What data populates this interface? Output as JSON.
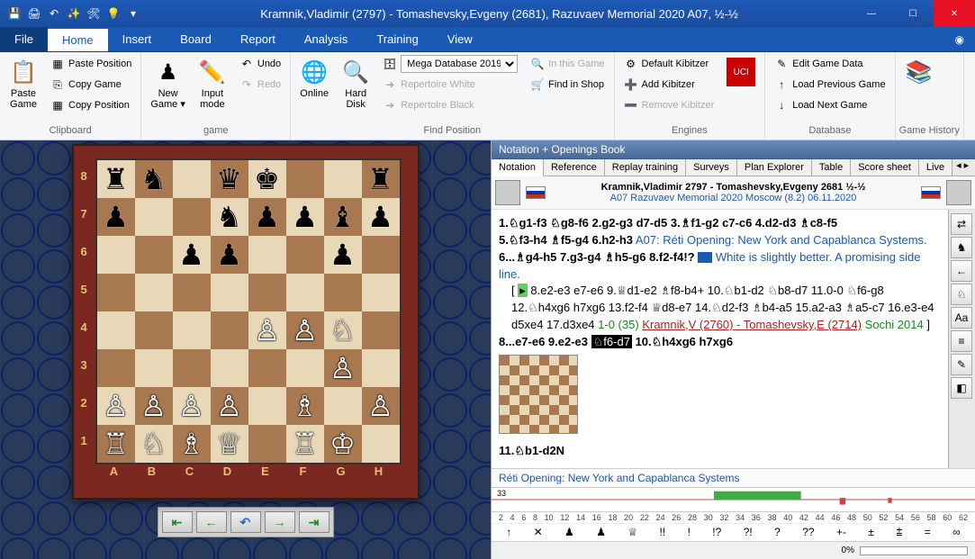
{
  "title": "Kramnik,Vladimir (2797) - Tomashevsky,Evgeny (2681), Razuvaev Memorial 2020  A07, ½-½",
  "menu": {
    "file": "File",
    "home": "Home",
    "insert": "Insert",
    "board": "Board",
    "report": "Report",
    "analysis": "Analysis",
    "training": "Training",
    "view": "View"
  },
  "ribbon": {
    "clipboard": {
      "title": "Clipboard",
      "paste_game": "Paste\nGame",
      "paste_position": "Paste Position",
      "copy_game": "Copy Game",
      "copy_position": "Copy Position"
    },
    "game": {
      "title": "game",
      "new_game": "New\nGame ▾",
      "input_mode": "Input\nmode",
      "undo": "Undo",
      "redo": "Redo"
    },
    "find": {
      "title": "Find Position",
      "online": "Online",
      "hard_disk": "Hard\nDisk",
      "db_select": "Mega Database 2019",
      "repertoire_white": "Repertoire White",
      "repertoire_black": "Repertoire Black",
      "in_this_game": "In this Game",
      "find_in_shop": "Find in Shop"
    },
    "engines": {
      "title": "Engines",
      "default_kibitzer": "Default Kibitzer",
      "add_kibitzer": "Add Kibitzer",
      "remove_kibitzer": "Remove Kibitzer"
    },
    "database": {
      "title": "Database",
      "edit_game": "Edit Game Data",
      "load_prev": "Load Previous Game",
      "load_next": "Load Next Game"
    },
    "history": {
      "title": "Game History"
    }
  },
  "board": {
    "ranks": [
      "8",
      "7",
      "6",
      "5",
      "4",
      "3",
      "2",
      "1"
    ],
    "files": [
      "A",
      "B",
      "C",
      "D",
      "E",
      "F",
      "G",
      "H"
    ],
    "position": [
      [
        "r",
        "n",
        ".",
        "q",
        "k",
        ".",
        ".",
        "r"
      ],
      [
        "p",
        ".",
        ".",
        "n",
        "p",
        "p",
        "b",
        "p"
      ],
      [
        ".",
        ".",
        "p",
        "p",
        ".",
        ".",
        "p",
        "."
      ],
      [
        ".",
        ".",
        ".",
        ".",
        ".",
        ".",
        ".",
        "."
      ],
      [
        ".",
        ".",
        ".",
        ".",
        "P",
        "P",
        "N",
        "."
      ],
      [
        ".",
        ".",
        ".",
        ".",
        ".",
        ".",
        "P",
        "."
      ],
      [
        "P",
        "P",
        "P",
        "P",
        ".",
        "B",
        ".",
        "P"
      ],
      [
        "R",
        "N",
        "B",
        "Q",
        ".",
        "R",
        "K",
        "."
      ]
    ]
  },
  "nav": {
    "first": "⇤",
    "prev": "←",
    "undo": "↶",
    "next": "→",
    "last": "⇥"
  },
  "pane": {
    "header": "Notation + Openings Book",
    "tabs": [
      "Notation",
      "Reference",
      "Replay training",
      "Surveys",
      "Plan Explorer",
      "Table",
      "Score sheet",
      "Live"
    ],
    "active_tab": 0,
    "game_header": {
      "white": "Kramnik,Vladimir",
      "white_elo": "2797",
      "black": "Tomashevsky,Evgeny",
      "black_elo": "2681",
      "result": "½-½",
      "event": "A07 Razuvaev Memorial 2020 Moscow (8.2) 06.11.2020"
    },
    "notation": {
      "main1": "1.♘g1-f3 ♘g8-f6 2.g2-g3 d7-d5 3.♗f1-g2 c7-c6 4.d2-d3 ♗c8-f5",
      "main2": "5.♘f3-h4 ♗f5-g4 6.h2-h3",
      "opening_link": "A07: Réti Opening: New York and Capablanca Systems.",
      "main3": "6...♗g4-h5 7.g3-g4 ♗h5-g6 8.f2-f4!?",
      "comment1": "White is slightly better. A promising side line.",
      "sub1": "8.e2-e3 e7-e6 9.♕d1-e2 ♗f8-b4+ 10.♘b1-d2 ♘b8-d7 11.0-0 ♘f6-g8 12.♘h4xg6 h7xg6 13.f2-f4 ♕d8-e7 14.♘d2-f3 ♗b4-a5 15.a2-a3 ♗a5-c7 16.e3-e4 d5xe4 17.d3xe4",
      "sub1_result": "1-0 (35)",
      "sub1_ref": "Kramnik,V (2760) - Tomashevsky,E (2714)",
      "sub1_place": "Sochi 2014",
      "main4": "8...e7-e6 9.e2-e3",
      "hl_move": "♘f6-d7",
      "main5": "10.♘h4xg6 h7xg6",
      "novelty": "11.♘b1-d2N"
    },
    "opening_bar": "Réti Opening: New York and Capablanca Systems",
    "eval_label": "33",
    "scale": [
      "2",
      "4",
      "6",
      "8",
      "10",
      "12",
      "14",
      "16",
      "18",
      "20",
      "22",
      "24",
      "26",
      "28",
      "30",
      "32",
      "34",
      "36",
      "38",
      "40",
      "42",
      "44",
      "46",
      "48",
      "50",
      "52",
      "54",
      "56",
      "58",
      "60",
      "62"
    ],
    "symbols": [
      "↑",
      "✕",
      "♟",
      "♟",
      "♕",
      "!!",
      "!",
      "!?",
      "?!",
      "?",
      "??",
      "+-",
      "±",
      "⩲",
      "=",
      "∞"
    ],
    "progress": "0%"
  },
  "side_tools": [
    "⇄",
    "♞",
    "←",
    "♘",
    "Aa",
    "≡",
    "✎",
    "◧"
  ]
}
